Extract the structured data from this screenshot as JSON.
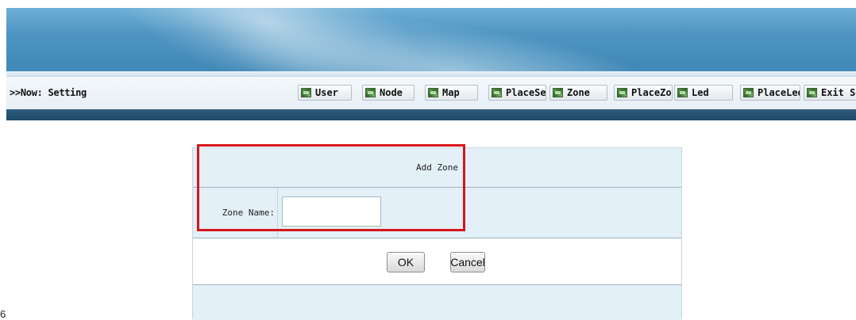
{
  "nav": {
    "where": ">>Now: Setting",
    "buttons": [
      {
        "label": "User",
        "icon": "green-square-icon"
      },
      {
        "label": "Node",
        "icon": "green-square-icon"
      },
      {
        "label": "Map",
        "icon": "green-square-icon"
      },
      {
        "label": "PlaceSet",
        "icon": "green-square-icon"
      },
      {
        "label": "Zone",
        "icon": "green-square-icon"
      },
      {
        "label": "PlaceZone",
        "icon": "green-square-icon"
      },
      {
        "label": "Led",
        "icon": "green-square-icon"
      },
      {
        "label": "PlaceLed",
        "icon": "green-square-icon"
      },
      {
        "label": "Exit Se",
        "icon": "green-square-icon"
      }
    ]
  },
  "form": {
    "title": "Add Zone",
    "zone_name_label": "Zone Name:",
    "zone_name_value": "",
    "ok_label": "OK",
    "cancel_label": "Cancel"
  },
  "footer": {
    "page_number": "6"
  },
  "colors": {
    "highlight": "#d6161b",
    "banner": "#4e95c2",
    "row_bg": "#e3f0f8",
    "dark_bar": "#1f4a69"
  }
}
